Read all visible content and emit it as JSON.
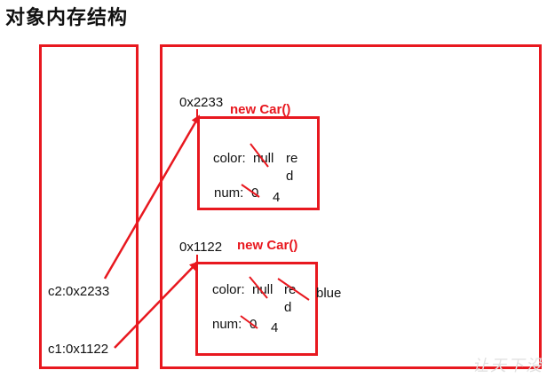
{
  "title": "对象内存结构",
  "stack": {
    "c2": "c2:0x2233",
    "c1": "c1:0x1122"
  },
  "heap": {
    "obj1": {
      "address": "0x2233",
      "constructor": "new Car()",
      "color_label": "color: ",
      "color_old": "null",
      "color_new_1": "re",
      "color_new_2": "d",
      "num_label": "num: ",
      "num_old": "0",
      "num_new": "4"
    },
    "obj2": {
      "address": "0x1122",
      "constructor": "new Car()",
      "color_label": "color: ",
      "color_old": "null",
      "color_new_1": "re",
      "color_new_2": "d",
      "color_new_3": "blue",
      "num_label": "num: ",
      "num_old": "0",
      "num_new": "4"
    }
  },
  "watermark": "让天下没",
  "colors": {
    "accent": "#e8181f",
    "text": "#111111"
  }
}
